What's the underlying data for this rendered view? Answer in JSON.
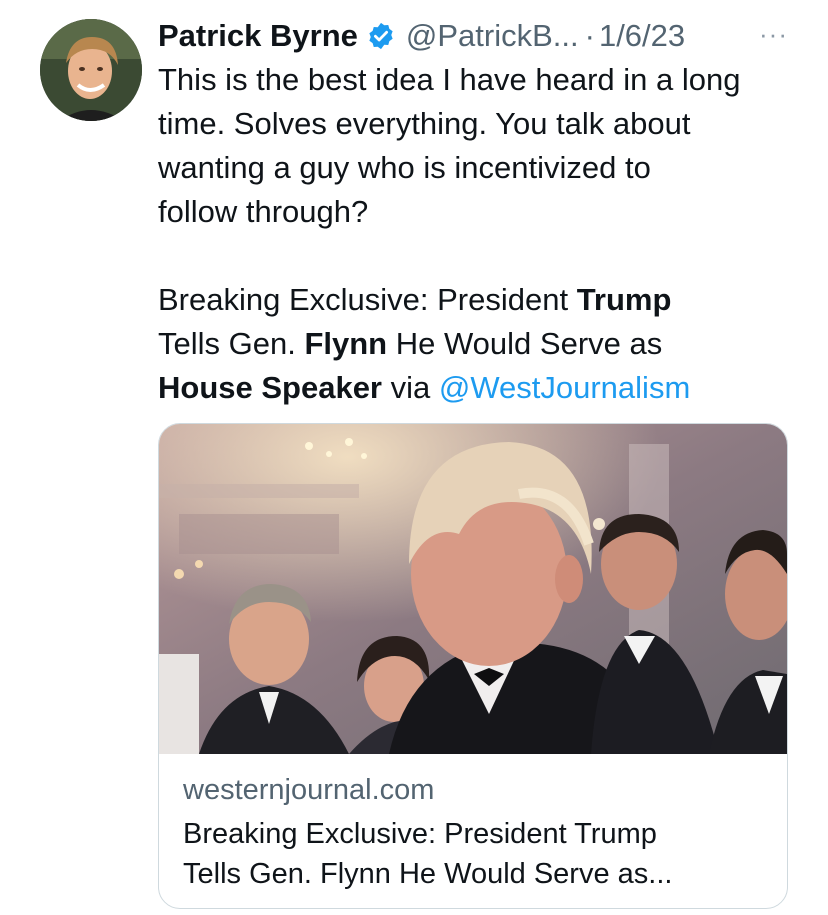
{
  "tweet": {
    "author_name": "Patrick Byrne",
    "author_handle": "@PatrickB...",
    "separator": "·",
    "date": "1/6/23",
    "more_label": "···",
    "text": {
      "line1": "This is the best idea I have heard in a long",
      "line2": "time. Solves everything. You talk about",
      "line3": "wanting a guy who is incentivized to",
      "line4": "follow through?",
      "headline_part1": "Breaking Exclusive: President ",
      "headline_bold1": "Trump",
      "headline_part2": "Tells Gen. ",
      "headline_bold2": "Flynn",
      "headline_part3": " He Would Serve as",
      "headline_bold3": "House Speaker",
      "headline_part4": " via ",
      "mention": "@WestJournalism"
    }
  },
  "link_card": {
    "domain": "westernjournal.com",
    "title_line1": "Breaking Exclusive: President Trump",
    "title_line2": "Tells Gen. Flynn He Would Serve as..."
  },
  "colors": {
    "link_blue": "#1d9bf0",
    "muted_gray": "#536471",
    "text": "#0f1419",
    "border": "#cfd9de"
  },
  "icons": {
    "verified": "verified-badge-icon",
    "more": "more-options-icon"
  }
}
